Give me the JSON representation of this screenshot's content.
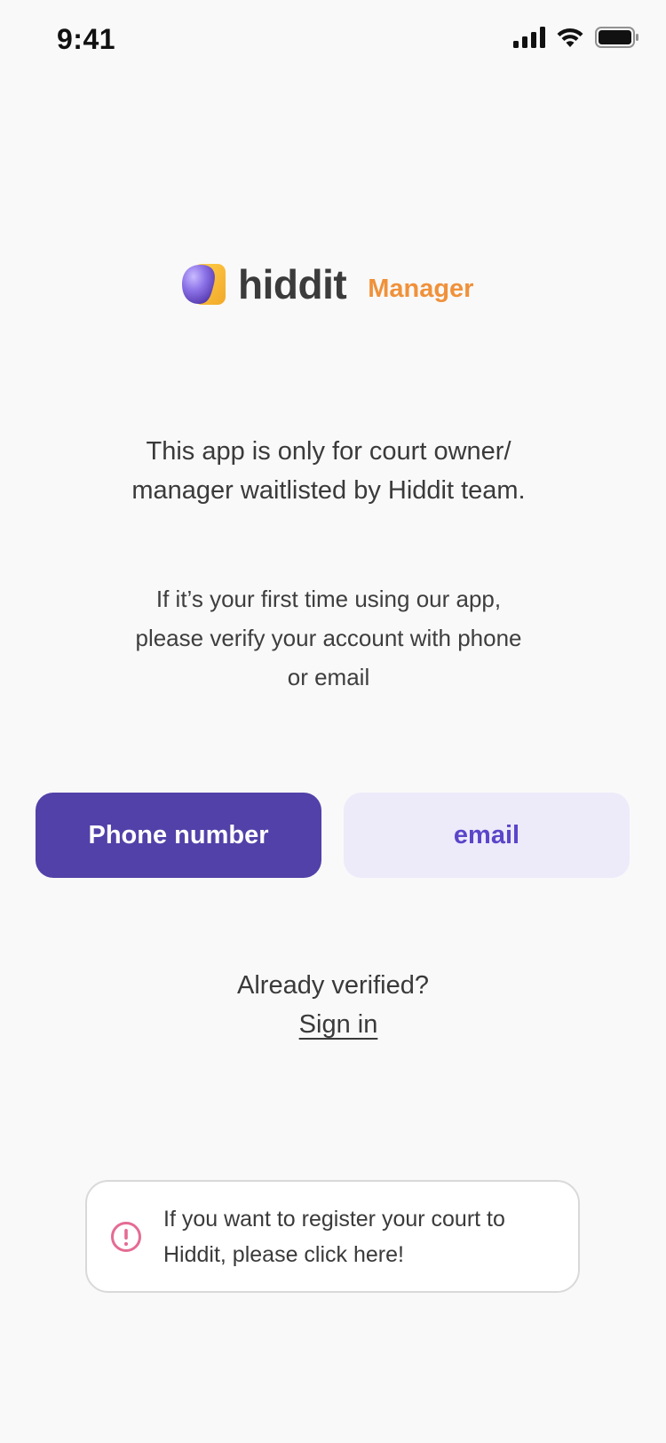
{
  "status_bar": {
    "time": "9:41",
    "icons": [
      "cellular-signal-icon",
      "wifi-icon",
      "battery-icon"
    ]
  },
  "logo": {
    "wordmark": "hiddit",
    "badge": "Manager"
  },
  "intro": {
    "line1": "This app is only for court owner/",
    "line2": "manager waitlisted by Hiddit team."
  },
  "verify": {
    "line1": "If it’s your first time using our app,",
    "line2": "please verify your account with phone",
    "line3": "or email"
  },
  "buttons": {
    "phone": "Phone number",
    "email": "email"
  },
  "signin": {
    "prompt": "Already verified?",
    "link": "Sign in"
  },
  "notice": {
    "icon": "alert-circle-icon",
    "line1": "If you want to register your court to",
    "line2": "Hiddit, please click here!"
  },
  "colors": {
    "primary": "#5141a8",
    "primary_light": "#edeafa",
    "primary_text": "#5b45c9",
    "accent_orange": "#f0913a",
    "alert_pink": "#e46c93",
    "background": "#f9f9f9"
  }
}
